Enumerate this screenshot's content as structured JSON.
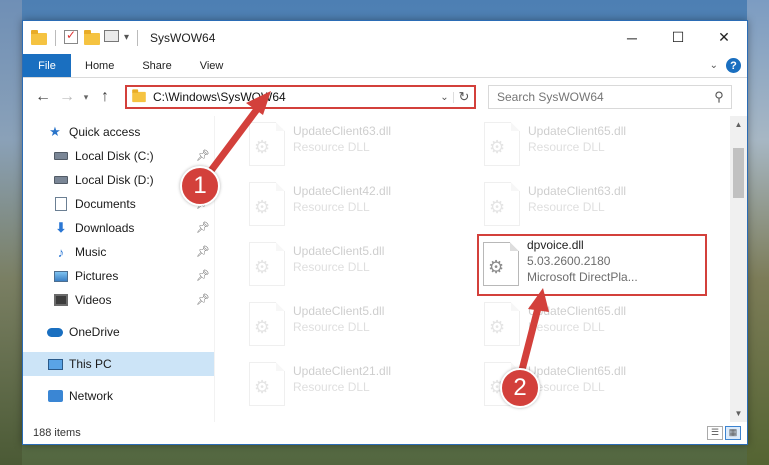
{
  "window": {
    "title": "SysWOW64",
    "minimize": "─",
    "maximize": "☐",
    "close": "✕"
  },
  "ribbon": {
    "tabs": [
      "File",
      "Home",
      "Share",
      "View"
    ],
    "help": "?"
  },
  "address": {
    "path": "C:\\Windows\\SysWOW64",
    "search_placeholder": "Search SysWOW64"
  },
  "nav": {
    "quick_access": "Quick access",
    "items": [
      {
        "label": "Local Disk (C:)",
        "icon": "drive-icon",
        "pinned": true
      },
      {
        "label": "Local Disk (D:)",
        "icon": "drive-icon",
        "pinned": false
      },
      {
        "label": "Documents",
        "icon": "documents-icon",
        "pinned": true
      },
      {
        "label": "Downloads",
        "icon": "downloads-icon",
        "pinned": true
      },
      {
        "label": "Music",
        "icon": "music-icon",
        "pinned": true
      },
      {
        "label": "Pictures",
        "icon": "pictures-icon",
        "pinned": true
      },
      {
        "label": "Videos",
        "icon": "videos-icon",
        "pinned": true
      }
    ],
    "onedrive": "OneDrive",
    "this_pc": "This PC",
    "network": "Network"
  },
  "files": {
    "col1": [
      {
        "name": "UpdateClient63.dll",
        "sub": "Resource DLL"
      },
      {
        "name": "UpdateClient42.dll",
        "sub": "Resource DLL"
      },
      {
        "name": "UpdateClient5.dll",
        "sub": "Resource DLL"
      },
      {
        "name": "UpdateClient5.dll",
        "sub": "Resource DLL"
      },
      {
        "name": "UpdateClient21.dll",
        "sub": "Resource DLL"
      }
    ],
    "col2": [
      {
        "name": "UpdateClient65.dll",
        "sub": "Resource DLL"
      },
      {
        "name": "UpdateClient63.dll",
        "sub": "Resource DLL"
      },
      {
        "name": "dpvoice.dll",
        "sub": "5.03.2600.2180",
        "sub2": "Microsoft DirectPla..."
      },
      {
        "name": "UpdateClient65.dll",
        "sub": "Resource DLL"
      },
      {
        "name": "UpdateClient65.dll",
        "sub": "Resource DLL"
      }
    ]
  },
  "status": {
    "items": "188 items"
  },
  "callouts": [
    "1",
    "2"
  ],
  "colors": {
    "accent": "#1a6fc0",
    "highlight": "#d3403b",
    "selected": "#cce4f7"
  }
}
